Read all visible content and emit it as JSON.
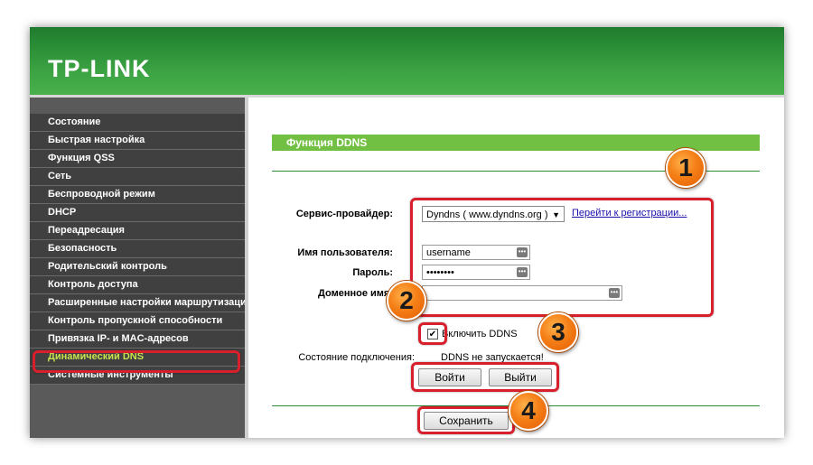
{
  "header": {
    "logo": "TP-LINK"
  },
  "sidebar": {
    "items": [
      {
        "label": "Состояние"
      },
      {
        "label": "Быстрая настройка"
      },
      {
        "label": "Функция QSS"
      },
      {
        "label": "Сеть"
      },
      {
        "label": "Беспроводной режим"
      },
      {
        "label": "DHCP"
      },
      {
        "label": "Переадресация"
      },
      {
        "label": "Безопасность"
      },
      {
        "label": "Родительский контроль"
      },
      {
        "label": "Контроль доступа"
      },
      {
        "label": "Расширенные настройки маршрутизации"
      },
      {
        "label": "Контроль пропускной способности"
      },
      {
        "label": "Привязка IP- и MAC-адресов"
      },
      {
        "label": "Динамический DNS",
        "active": true
      },
      {
        "label": "Системные инструменты"
      }
    ]
  },
  "main": {
    "title": "Функция DDNS",
    "provider_label": "Сервис-провайдер:",
    "provider_value": "Dyndns ( www.dyndns.org )",
    "register_link": "Перейти к регистрации...",
    "username_label": "Имя пользователя:",
    "username_value": "username",
    "password_label": "Пароль:",
    "password_value": "••••••••",
    "domain_label": "Доменное имя:",
    "domain_value": "",
    "enable_label": "Включить DDNS",
    "enable_checked": "✔",
    "status_label": "Состояние подключения:",
    "status_value": "DDNS не запускается!",
    "login_button": "Войти",
    "logout_button": "Выйти",
    "save_button": "Сохранить"
  },
  "annotations": [
    "1",
    "2",
    "3",
    "4"
  ],
  "colors": {
    "accent_green": "#72c043",
    "highlight_red": "#d81f2c",
    "badge_orange": "#f57f17",
    "active_nav": "#c6e34e"
  }
}
